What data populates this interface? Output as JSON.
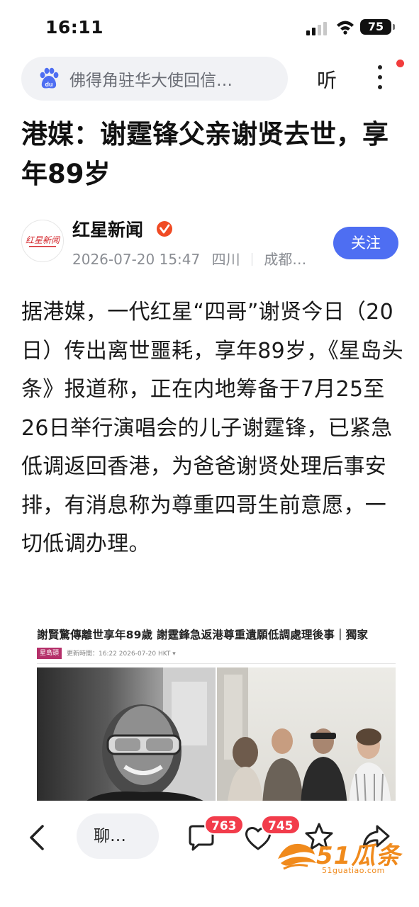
{
  "status_bar": {
    "time": "16:11",
    "battery": "75"
  },
  "search": {
    "text": "佛得角驻华大使回信…",
    "listen_label": "听"
  },
  "article": {
    "title": "港媒：谢霆锋父亲谢贤去世，享年89岁",
    "author": "红星新闻",
    "date": "2026-07-20 15:47",
    "province": "四川",
    "city": "成都…",
    "follow_label": "关注",
    "logo_text": "红星新闻",
    "body": "据港媒，一代红星“四哥”谢贤今日（20日）传出离世噩耗，享年89岁，《星岛头条》报道称，正在内地筹备于7月25至26日举行演唱会的儿子谢霆锋，已紧急低调返回香港，为爸爸谢贤处理后事安排，有消息称为尊重四哥生前意愿，一切低调办理。"
  },
  "embed": {
    "headline": "謝賢驚傳離世享年89歲 謝霆鋒急返港尊重遺願低調處理後事｜獨家",
    "tag": "星島頭",
    "meta": "更新時間：16:22 2026-07-20 HKT ▾"
  },
  "bottom_bar": {
    "chat_label": "聊…",
    "comment_count": "763",
    "like_count": "745"
  },
  "watermark": {
    "main": "51瓜条",
    "sub": "51guatiao.com"
  },
  "colors": {
    "accent": "#4e6ef2",
    "badge": "#f23c4b",
    "watermark": "#f08a1c"
  }
}
